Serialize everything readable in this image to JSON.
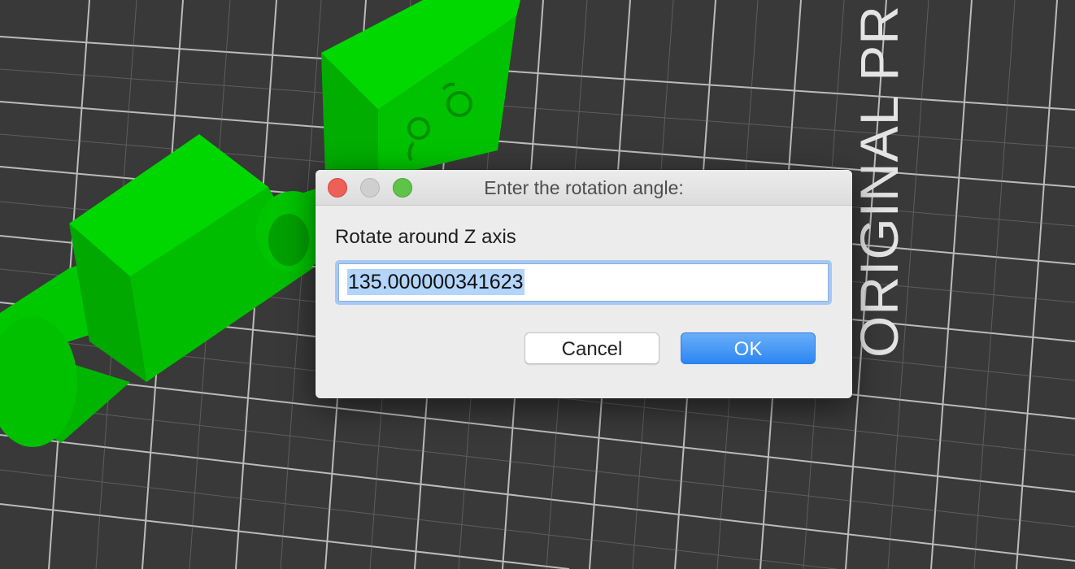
{
  "viewport": {
    "bed_label": "ORIGINAL PR",
    "model_color": "#00d400",
    "bed_color": "#3a3a3a",
    "grid_color": "#cfcfcf"
  },
  "dialog": {
    "title": "Enter the rotation angle:",
    "prompt": "Rotate around Z axis",
    "input_value": "135.000000341623",
    "cancel_label": "Cancel",
    "ok_label": "OK",
    "accent_color": "#2b86f4"
  }
}
